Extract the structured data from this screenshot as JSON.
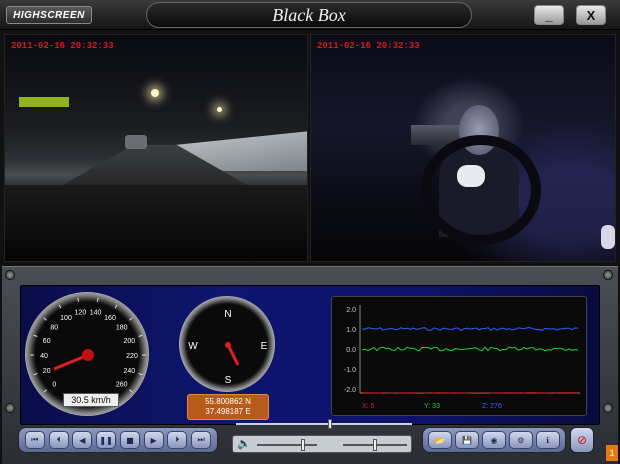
{
  "app": {
    "brand": "HIGHSCREEN",
    "title": "Black Box",
    "minimize_label": "_",
    "close_label": "X"
  },
  "video": {
    "front_timestamp": "2011-02-16 20:32:33",
    "cabin_timestamp": "2011-02-16 20:32:33"
  },
  "speedometer": {
    "ticks": [
      "0",
      "20",
      "40",
      "60",
      "80",
      "100",
      "120",
      "140",
      "160",
      "180",
      "200",
      "220",
      "240",
      "260"
    ],
    "speed": "30.5 km/h"
  },
  "compass": {
    "north": "N",
    "south": "S",
    "east": "E",
    "west": "W"
  },
  "gps": {
    "latitude": "55.800862 N",
    "longitude": "37.498187 E"
  },
  "accel_graph": {
    "y_ticks": [
      "2.0",
      "1.0",
      "0.0",
      "-1.0",
      "-2.0"
    ],
    "x_label": "X: 5",
    "y_label": "Y: 33",
    "z_label": "Z: 276",
    "colors": {
      "x": "#e02020",
      "y": "#20d040",
      "z": "#3060ff"
    }
  },
  "playback": {
    "buttons": [
      {
        "name": "skip-start-button",
        "icon": "⏮"
      },
      {
        "name": "step-back-button",
        "icon": "⏴"
      },
      {
        "name": "rewind-button",
        "icon": "◀"
      },
      {
        "name": "pause-button",
        "icon": "❚❚"
      },
      {
        "name": "stop-button",
        "icon": "■"
      },
      {
        "name": "play-button",
        "icon": "▶"
      },
      {
        "name": "step-forward-button",
        "icon": "⏵"
      },
      {
        "name": "skip-end-button",
        "icon": "⏭"
      }
    ],
    "volume_icon": "🔈",
    "progress": 0.52
  },
  "tools": {
    "buttons": [
      {
        "name": "open-folder-button",
        "icon": "📂"
      },
      {
        "name": "save-button",
        "icon": "💾"
      },
      {
        "name": "map-button",
        "icon": "◉"
      },
      {
        "name": "settings-gear-button",
        "icon": "⚙"
      },
      {
        "name": "info-button",
        "icon": "ℹ"
      }
    ],
    "settings_icon": "⊘",
    "page_badge": "1"
  }
}
